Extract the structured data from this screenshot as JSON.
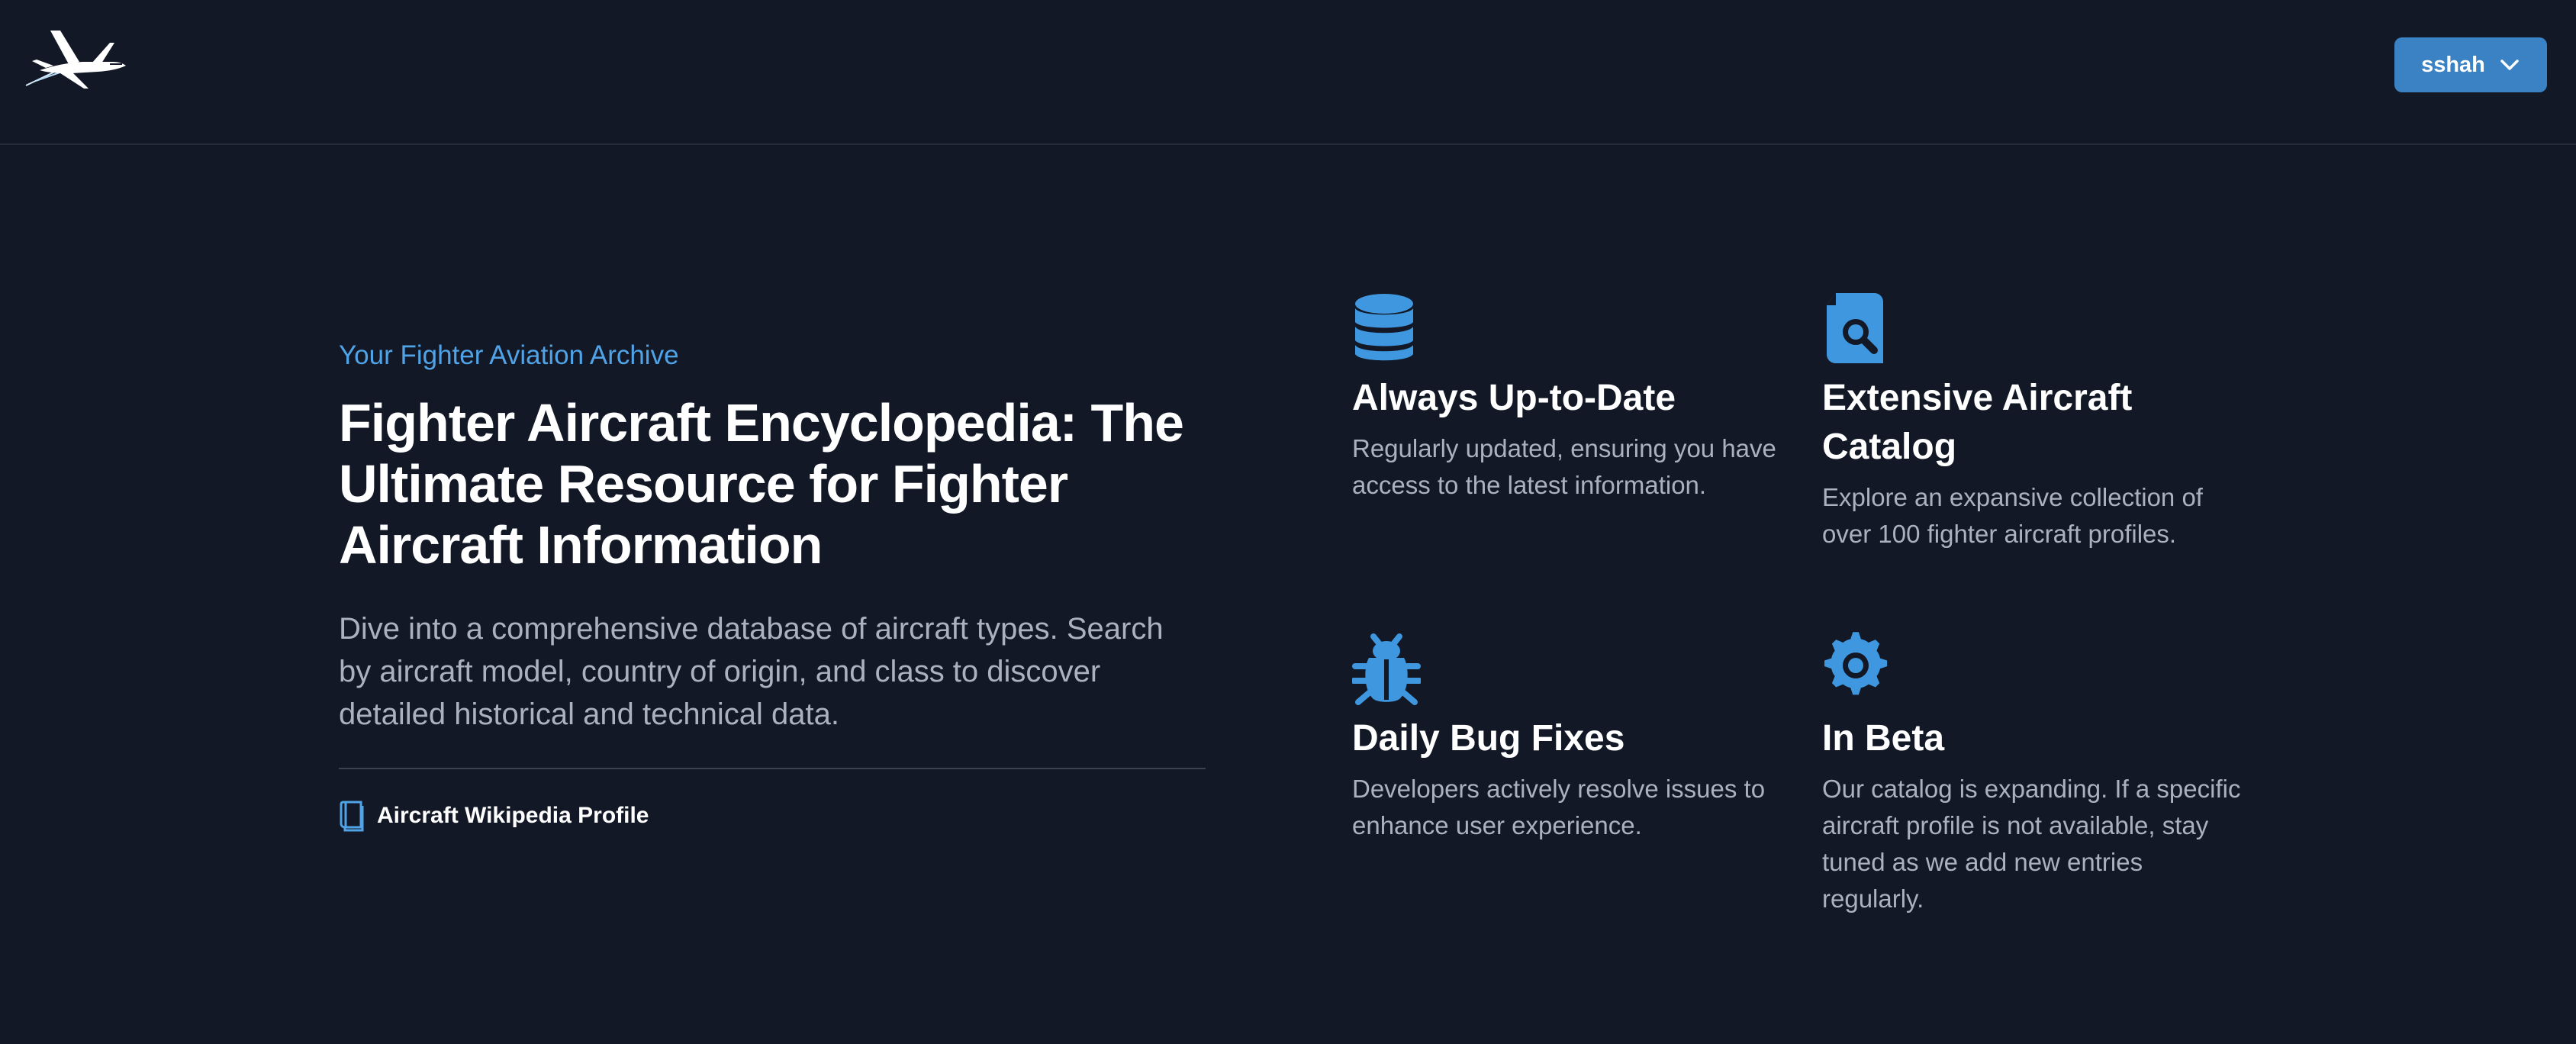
{
  "brand": {
    "logo_icon": "fighter-jet-icon"
  },
  "user_menu": {
    "label": "sshah",
    "icon": "chevron-down-icon"
  },
  "hero": {
    "eyebrow": "Your Fighter Aviation Archive",
    "title": "Fighter Aircraft Encyclopedia: The Ultimate Resource for Fighter Aircraft Information",
    "description": "Dive into a comprehensive database of aircraft types. Search by aircraft model, country of origin, and class to discover detailed historical and technical data.",
    "link_label": "Aircraft Wikipedia Profile",
    "link_icon": "book-icon"
  },
  "features": [
    {
      "icon": "database-icon",
      "title": "Always Up-to-Date",
      "description": "Regularly updated, ensuring you have access to the latest information."
    },
    {
      "icon": "file-search-icon",
      "title": "Extensive Aircraft Catalog",
      "description": "Explore an expansive collection of over 100 fighter aircraft profiles."
    },
    {
      "icon": "bug-icon",
      "title": "Daily Bug Fixes",
      "description": "Developers actively resolve issues to enhance user experience."
    },
    {
      "icon": "gear-icon",
      "title": "In Beta",
      "description": "Our catalog is expanding. If a specific aircraft profile is not available, stay tuned as we add new entries regularly."
    }
  ],
  "colors": {
    "background": "#121826",
    "accent": "#3b82c4",
    "eyebrow": "#4fa3e6",
    "muted_text": "#aab2c0"
  }
}
